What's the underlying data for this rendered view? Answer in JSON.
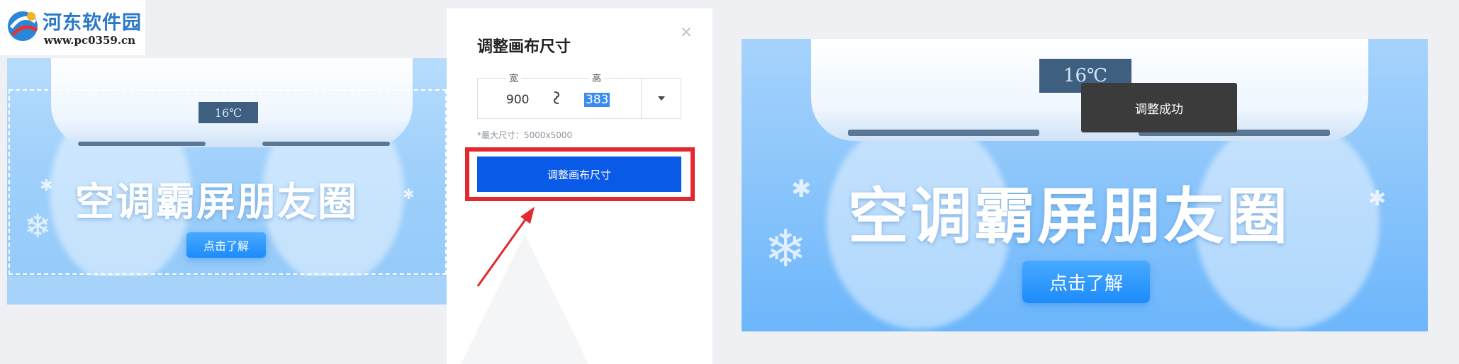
{
  "watermark": {
    "name": "河东软件园",
    "url": "www.pc0359.cn"
  },
  "left_preview": {
    "temperature": "16℃",
    "poster_title": "空调霸屏朋友圈",
    "poster_button": "点击了解"
  },
  "dialog": {
    "title": "调整画布尺寸",
    "width_label": "宽",
    "height_label": "高",
    "width_value": "900",
    "height_value": "383",
    "max_size_hint": "*最大尺寸：5000x5000",
    "confirm_button": "调整画布尺寸"
  },
  "right_preview": {
    "temperature": "16℃",
    "poster_title": "空调霸屏朋友圈",
    "poster_button": "点击了解",
    "toast": "调整成功"
  },
  "colors": {
    "primary_button": "#0a5ae8",
    "highlight_frame": "#e3282e",
    "poster_blue": "#8dc6fb",
    "toast_bg": "#3b3b3b"
  }
}
